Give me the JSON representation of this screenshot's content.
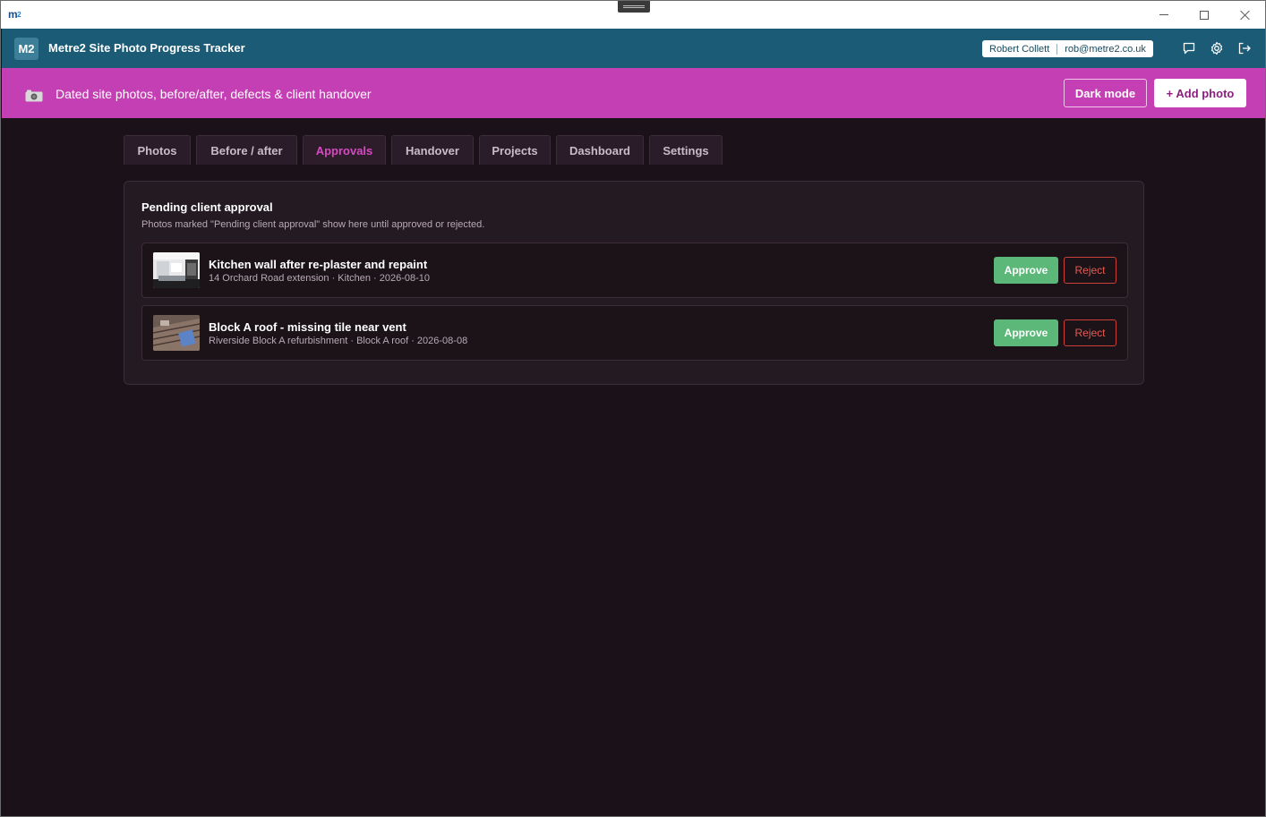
{
  "os": {
    "logo": "m",
    "logo_sub": "2"
  },
  "header": {
    "badge": "M2",
    "title": "Metre2 Site Photo Progress Tracker",
    "user_name": "Robert Collett",
    "user_email": "rob@metre2.co.uk",
    "icons": [
      "chat-icon",
      "gear-icon",
      "logout-icon"
    ]
  },
  "banner": {
    "text": "Dated site photos, before/after, defects & client handover",
    "dark_mode_label": "Dark mode",
    "add_photo_label": "+ Add photo",
    "color": "#c43fb3"
  },
  "tabs": [
    {
      "label": "Photos",
      "active": false
    },
    {
      "label": "Before / after",
      "active": false
    },
    {
      "label": "Approvals",
      "active": true
    },
    {
      "label": "Handover",
      "active": false
    },
    {
      "label": "Projects",
      "active": false
    },
    {
      "label": "Dashboard",
      "active": false
    },
    {
      "label": "Settings",
      "active": false
    }
  ],
  "approvals": {
    "title": "Pending client approval",
    "subtitle": "Photos marked \"Pending client approval\" show here until approved or rejected.",
    "items": [
      {
        "title": "Kitchen wall after re-plaster and repaint",
        "meta": "14 Orchard Road extension · Kitchen · 2026-08-10",
        "approve_label": "Approve",
        "reject_label": "Reject"
      },
      {
        "title": "Block A roof - missing tile near vent",
        "meta": "Riverside Block A refurbishment · Block A roof · 2026-08-08",
        "approve_label": "Approve",
        "reject_label": "Reject"
      }
    ]
  },
  "colors": {
    "header": "#1b5b76",
    "accent": "#d54ac1",
    "approve": "#5bb879",
    "reject": "#e45a52",
    "background": "#1a1218"
  }
}
